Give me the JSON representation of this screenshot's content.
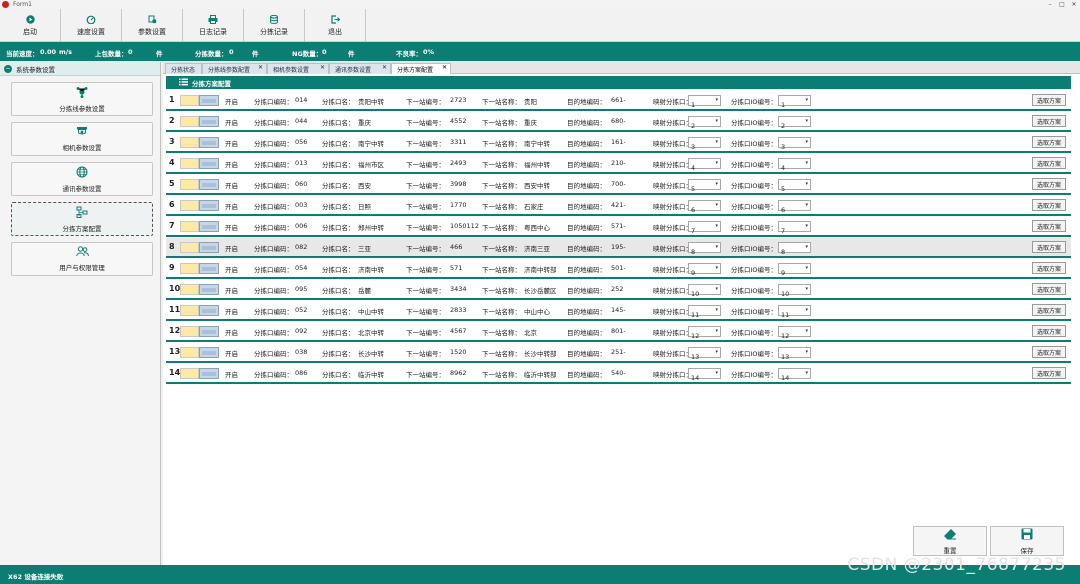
{
  "window": {
    "title": "Form1"
  },
  "toolbar": [
    {
      "label": "启动",
      "icon": "play-icon"
    },
    {
      "label": "速度设置",
      "icon": "gauge-icon"
    },
    {
      "label": "参数设置",
      "icon": "settings-icon"
    },
    {
      "label": "日志记录",
      "icon": "printer-icon"
    },
    {
      "label": "分拣记录",
      "icon": "database-icon"
    },
    {
      "label": "退出",
      "icon": "exit-icon"
    }
  ],
  "status": {
    "speed_label": "当前速度：",
    "speed_value": "0.00",
    "speed_unit": "m/s",
    "upload_label": "上包数量：",
    "upload_value": "0",
    "upload_unit": "件",
    "sorted_label": "分拣数量：",
    "sorted_value": "0",
    "sorted_unit": "件",
    "ng_label": "NG数量：",
    "ng_value": "0",
    "ng_unit": "件",
    "rate_label": "不良率：",
    "rate_value": "0%"
  },
  "sidebar": {
    "title": "系统参数设置",
    "items": [
      {
        "label": "分拣线参数设置",
        "icon": "network-icon"
      },
      {
        "label": "相机参数设置",
        "icon": "camera-icon"
      },
      {
        "label": "通讯参数设置",
        "icon": "globe-icon"
      },
      {
        "label": "分拣方案配置",
        "icon": "flow-icon"
      },
      {
        "label": "用户与权限管理",
        "icon": "users-icon"
      }
    ]
  },
  "tabs": [
    {
      "label": "分拣状态"
    },
    {
      "label": "分拣线参数配置"
    },
    {
      "label": "相机参数设置"
    },
    {
      "label": "通讯参数设置"
    },
    {
      "label": "分拣方案配置"
    }
  ],
  "panel": {
    "title": "分拣方案配置"
  },
  "labels": {
    "open": "开启",
    "port_code": "分拣口编码：",
    "port_name": "分拣口名：",
    "next_code": "下一站编号：",
    "next_name": "下一站名称：",
    "dest_code": "目的地编码：",
    "map_port": "映射分拣口：",
    "io_port": "分拣口IO编号：",
    "fetch": "选取方案"
  },
  "rows": [
    {
      "n": "1",
      "code": "014",
      "name": "贵阳中转",
      "next_code": "2723",
      "next_name": "贵阳",
      "dest": "661-",
      "map": "1",
      "io": "1"
    },
    {
      "n": "2",
      "code": "044",
      "name": "重庆",
      "next_code": "4552",
      "next_name": "重庆",
      "dest": "680-",
      "map": "2",
      "io": "2"
    },
    {
      "n": "3",
      "code": "056",
      "name": "南宁中转",
      "next_code": "3311",
      "next_name": "南宁中转",
      "dest": "161-",
      "map": "3",
      "io": "3"
    },
    {
      "n": "4",
      "code": "013",
      "name": "福州市区",
      "next_code": "2493",
      "next_name": "福州中转",
      "dest": "210-",
      "map": "4",
      "io": "4"
    },
    {
      "n": "5",
      "code": "060",
      "name": "西安",
      "next_code": "3998",
      "next_name": "西安中转",
      "dest": "700-",
      "map": "5",
      "io": "5"
    },
    {
      "n": "6",
      "code": "003",
      "name": "日照",
      "next_code": "1770",
      "next_name": "石家庄",
      "dest": "421-",
      "map": "6",
      "io": "6"
    },
    {
      "n": "7",
      "code": "006",
      "name": "郑州中转",
      "next_code": "1050112",
      "next_name": "粤西中心",
      "dest": "571-",
      "map": "7",
      "io": "7"
    },
    {
      "n": "8",
      "code": "082",
      "name": "三亚",
      "next_code": "466",
      "next_name": "济南三亚",
      "dest": "195-",
      "map": "8",
      "io": "8"
    },
    {
      "n": "9",
      "code": "054",
      "name": "济南中转",
      "next_code": "571",
      "next_name": "济南中转部",
      "dest": "501-",
      "map": "9",
      "io": "9"
    },
    {
      "n": "10",
      "code": "095",
      "name": "岳麓",
      "next_code": "3434",
      "next_name": "长沙岳麓区",
      "dest": "252",
      "map": "10",
      "io": "10"
    },
    {
      "n": "11",
      "code": "052",
      "name": "中山中转",
      "next_code": "2833",
      "next_name": "中山中心",
      "dest": "145-",
      "map": "11",
      "io": "11"
    },
    {
      "n": "12",
      "code": "092",
      "name": "北京中转",
      "next_code": "4567",
      "next_name": "北京",
      "dest": "801-",
      "map": "12",
      "io": "12"
    },
    {
      "n": "13",
      "code": "038",
      "name": "长沙中转",
      "next_code": "1520",
      "next_name": "长沙中转部",
      "dest": "251-",
      "map": "13",
      "io": "13"
    },
    {
      "n": "14",
      "code": "086",
      "name": "临沂中转",
      "next_code": "8962",
      "next_name": "临沂中转部",
      "dest": "540-",
      "map": "14",
      "io": "14"
    }
  ],
  "actions": {
    "reset": "重置",
    "save": "保存"
  },
  "bottom": {
    "message": "X62 设备连接失败",
    "watermark": "CSDN @2301_76877235"
  },
  "colors": {
    "accent": "#0c7d72",
    "row_highlight": "#e8e8e8"
  }
}
